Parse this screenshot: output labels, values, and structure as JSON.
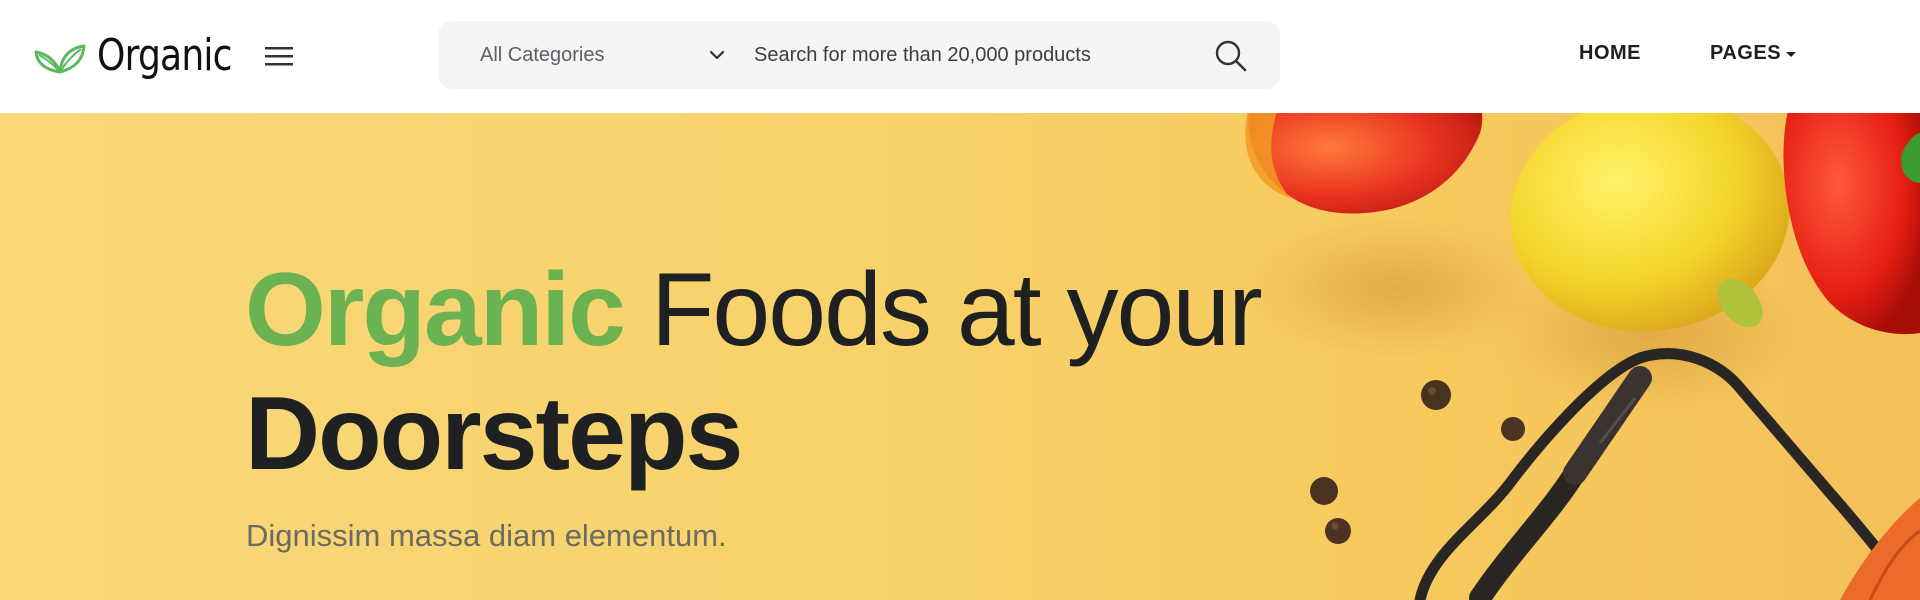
{
  "brand": {
    "name": "Organic",
    "logo_icon": "leaf-icon",
    "accent_color": "#6bb252"
  },
  "header": {
    "menu_icon": "hamburger-menu-icon",
    "search": {
      "category_selected": "All Categories",
      "placeholder": "Search for more than 20,000 products",
      "value": "",
      "icon": "search-icon"
    },
    "nav": {
      "home": "HOME",
      "pages": "PAGES"
    }
  },
  "hero": {
    "title_accent": "Organic",
    "title_rest": "Foods at your",
    "title_line2": "Doorsteps",
    "subtitle": "Dignissim massa diam elementum.",
    "background_color": "#f8d26a"
  }
}
